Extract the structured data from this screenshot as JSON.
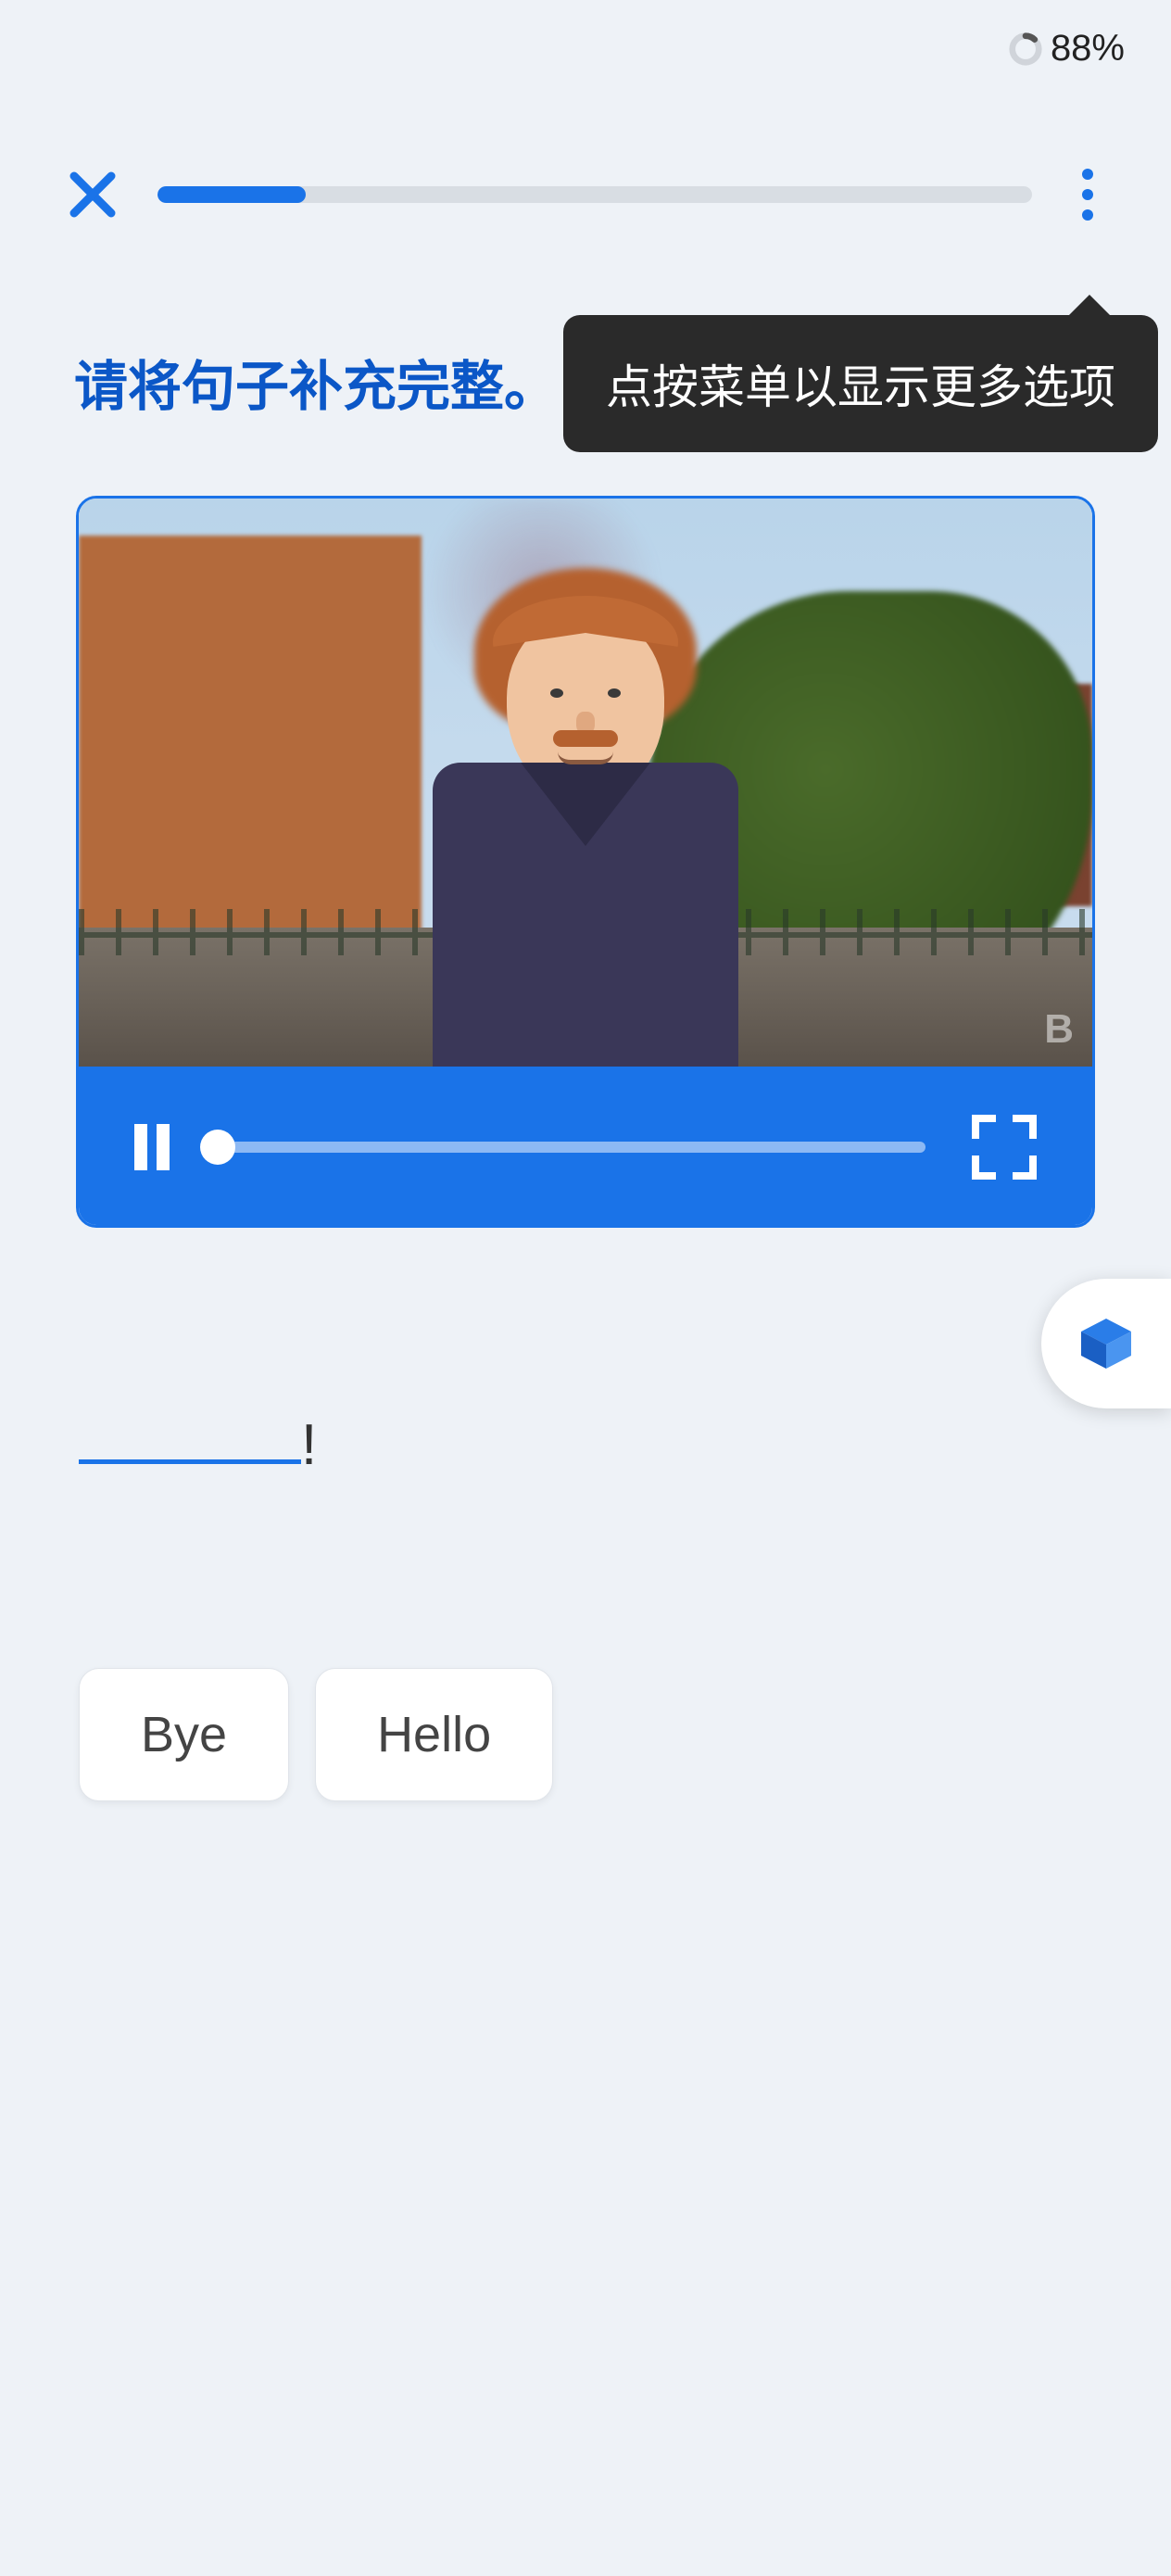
{
  "status": {
    "battery_percent": "88%"
  },
  "progress": {
    "fill_percent": 17
  },
  "tooltip": {
    "text": "点按菜单以显示更多选项"
  },
  "prompt": {
    "text": "请将句子补充完整。"
  },
  "video": {
    "watermark": "B",
    "seek_percent": 0
  },
  "sentence": {
    "suffix": "!"
  },
  "choices": [
    "Bye",
    "Hello"
  ]
}
